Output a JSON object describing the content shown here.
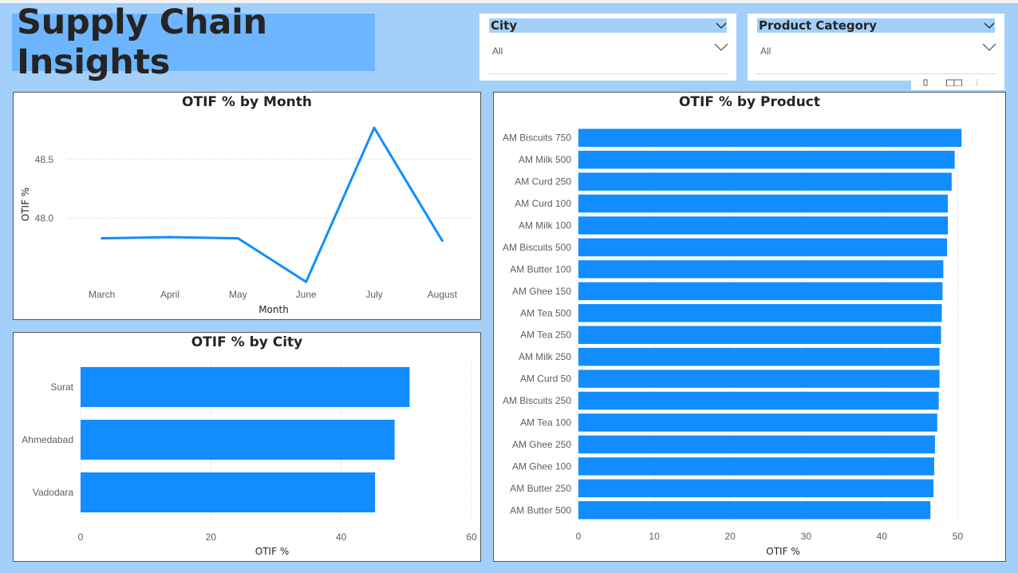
{
  "report": {
    "title": "Supply Chain Insights"
  },
  "slicers": [
    {
      "label": "City",
      "value": "All"
    },
    {
      "label": "Product Category",
      "value": "All"
    }
  ],
  "visual_header_icons": [
    "pin-icon",
    "focus-mode-icon",
    "more-options-icon"
  ],
  "colors": {
    "background": "#a3d0fb",
    "title_bg": "#6db6ff",
    "bar": "#118dff",
    "line": "#118dff"
  },
  "chart_data": [
    {
      "id": "month",
      "type": "line",
      "title": "OTIF % by Month",
      "xlabel": "Month",
      "ylabel": "OTIF %",
      "categories": [
        "March",
        "April",
        "May",
        "June",
        "July",
        "August"
      ],
      "values": [
        47.83,
        47.84,
        47.83,
        47.46,
        48.77,
        47.81
      ],
      "ylim": [
        47.4,
        48.9
      ],
      "yticks": [
        48.0,
        48.5
      ],
      "ytick_labels": [
        "48.0",
        "48.5"
      ],
      "grid": true
    },
    {
      "id": "city",
      "type": "bar",
      "orientation": "horizontal",
      "title": "OTIF % by City",
      "xlabel": "OTIF %",
      "categories": [
        "Surat",
        "Ahmedabad",
        "Vadodara"
      ],
      "values": [
        50.5,
        48.2,
        45.2
      ],
      "xlim": [
        0,
        60
      ],
      "xticks": [
        0,
        20,
        40,
        60
      ],
      "grid": true
    },
    {
      "id": "product",
      "type": "bar",
      "orientation": "horizontal",
      "title": "OTIF % by Product",
      "xlabel": "OTIF %",
      "categories": [
        "AM Biscuits 750",
        "AM Milk 500",
        "AM Curd 250",
        "AM Curd 100",
        "AM Milk 100",
        "AM Biscuits 500",
        "AM Butter 100",
        "AM Ghee 150",
        "AM Tea 500",
        "AM Tea 250",
        "AM Milk 250",
        "AM Curd 50",
        "AM Biscuits 250",
        "AM Tea 100",
        "AM Ghee 250",
        "AM Ghee 100",
        "AM Butter 250",
        "AM Butter 500"
      ],
      "values": [
        50.5,
        49.6,
        49.2,
        48.7,
        48.7,
        48.6,
        48.1,
        48.0,
        47.9,
        47.8,
        47.6,
        47.6,
        47.5,
        47.3,
        47.0,
        46.9,
        46.8,
        46.4
      ],
      "xlim": [
        0,
        55
      ],
      "xticks": [
        0,
        10,
        20,
        30,
        40,
        50
      ],
      "grid": true
    }
  ]
}
